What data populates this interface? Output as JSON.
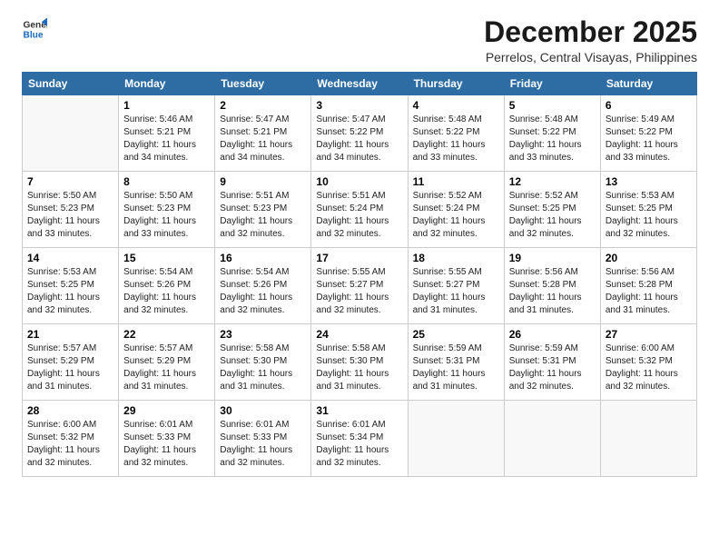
{
  "logo": {
    "general": "General",
    "blue": "Blue"
  },
  "title": "December 2025",
  "location": "Perrelos, Central Visayas, Philippines",
  "headers": [
    "Sunday",
    "Monday",
    "Tuesday",
    "Wednesday",
    "Thursday",
    "Friday",
    "Saturday"
  ],
  "weeks": [
    [
      {
        "day": "",
        "sunrise": "",
        "sunset": "",
        "daylight": "",
        "empty": true
      },
      {
        "day": "1",
        "sunrise": "Sunrise: 5:46 AM",
        "sunset": "Sunset: 5:21 PM",
        "daylight": "Daylight: 11 hours and 34 minutes."
      },
      {
        "day": "2",
        "sunrise": "Sunrise: 5:47 AM",
        "sunset": "Sunset: 5:21 PM",
        "daylight": "Daylight: 11 hours and 34 minutes."
      },
      {
        "day": "3",
        "sunrise": "Sunrise: 5:47 AM",
        "sunset": "Sunset: 5:22 PM",
        "daylight": "Daylight: 11 hours and 34 minutes."
      },
      {
        "day": "4",
        "sunrise": "Sunrise: 5:48 AM",
        "sunset": "Sunset: 5:22 PM",
        "daylight": "Daylight: 11 hours and 33 minutes."
      },
      {
        "day": "5",
        "sunrise": "Sunrise: 5:48 AM",
        "sunset": "Sunset: 5:22 PM",
        "daylight": "Daylight: 11 hours and 33 minutes."
      },
      {
        "day": "6",
        "sunrise": "Sunrise: 5:49 AM",
        "sunset": "Sunset: 5:22 PM",
        "daylight": "Daylight: 11 hours and 33 minutes."
      }
    ],
    [
      {
        "day": "7",
        "sunrise": "Sunrise: 5:50 AM",
        "sunset": "Sunset: 5:23 PM",
        "daylight": "Daylight: 11 hours and 33 minutes."
      },
      {
        "day": "8",
        "sunrise": "Sunrise: 5:50 AM",
        "sunset": "Sunset: 5:23 PM",
        "daylight": "Daylight: 11 hours and 33 minutes."
      },
      {
        "day": "9",
        "sunrise": "Sunrise: 5:51 AM",
        "sunset": "Sunset: 5:23 PM",
        "daylight": "Daylight: 11 hours and 32 minutes."
      },
      {
        "day": "10",
        "sunrise": "Sunrise: 5:51 AM",
        "sunset": "Sunset: 5:24 PM",
        "daylight": "Daylight: 11 hours and 32 minutes."
      },
      {
        "day": "11",
        "sunrise": "Sunrise: 5:52 AM",
        "sunset": "Sunset: 5:24 PM",
        "daylight": "Daylight: 11 hours and 32 minutes."
      },
      {
        "day": "12",
        "sunrise": "Sunrise: 5:52 AM",
        "sunset": "Sunset: 5:25 PM",
        "daylight": "Daylight: 11 hours and 32 minutes."
      },
      {
        "day": "13",
        "sunrise": "Sunrise: 5:53 AM",
        "sunset": "Sunset: 5:25 PM",
        "daylight": "Daylight: 11 hours and 32 minutes."
      }
    ],
    [
      {
        "day": "14",
        "sunrise": "Sunrise: 5:53 AM",
        "sunset": "Sunset: 5:25 PM",
        "daylight": "Daylight: 11 hours and 32 minutes."
      },
      {
        "day": "15",
        "sunrise": "Sunrise: 5:54 AM",
        "sunset": "Sunset: 5:26 PM",
        "daylight": "Daylight: 11 hours and 32 minutes."
      },
      {
        "day": "16",
        "sunrise": "Sunrise: 5:54 AM",
        "sunset": "Sunset: 5:26 PM",
        "daylight": "Daylight: 11 hours and 32 minutes."
      },
      {
        "day": "17",
        "sunrise": "Sunrise: 5:55 AM",
        "sunset": "Sunset: 5:27 PM",
        "daylight": "Daylight: 11 hours and 32 minutes."
      },
      {
        "day": "18",
        "sunrise": "Sunrise: 5:55 AM",
        "sunset": "Sunset: 5:27 PM",
        "daylight": "Daylight: 11 hours and 31 minutes."
      },
      {
        "day": "19",
        "sunrise": "Sunrise: 5:56 AM",
        "sunset": "Sunset: 5:28 PM",
        "daylight": "Daylight: 11 hours and 31 minutes."
      },
      {
        "day": "20",
        "sunrise": "Sunrise: 5:56 AM",
        "sunset": "Sunset: 5:28 PM",
        "daylight": "Daylight: 11 hours and 31 minutes."
      }
    ],
    [
      {
        "day": "21",
        "sunrise": "Sunrise: 5:57 AM",
        "sunset": "Sunset: 5:29 PM",
        "daylight": "Daylight: 11 hours and 31 minutes."
      },
      {
        "day": "22",
        "sunrise": "Sunrise: 5:57 AM",
        "sunset": "Sunset: 5:29 PM",
        "daylight": "Daylight: 11 hours and 31 minutes."
      },
      {
        "day": "23",
        "sunrise": "Sunrise: 5:58 AM",
        "sunset": "Sunset: 5:30 PM",
        "daylight": "Daylight: 11 hours and 31 minutes."
      },
      {
        "day": "24",
        "sunrise": "Sunrise: 5:58 AM",
        "sunset": "Sunset: 5:30 PM",
        "daylight": "Daylight: 11 hours and 31 minutes."
      },
      {
        "day": "25",
        "sunrise": "Sunrise: 5:59 AM",
        "sunset": "Sunset: 5:31 PM",
        "daylight": "Daylight: 11 hours and 31 minutes."
      },
      {
        "day": "26",
        "sunrise": "Sunrise: 5:59 AM",
        "sunset": "Sunset: 5:31 PM",
        "daylight": "Daylight: 11 hours and 32 minutes."
      },
      {
        "day": "27",
        "sunrise": "Sunrise: 6:00 AM",
        "sunset": "Sunset: 5:32 PM",
        "daylight": "Daylight: 11 hours and 32 minutes."
      }
    ],
    [
      {
        "day": "28",
        "sunrise": "Sunrise: 6:00 AM",
        "sunset": "Sunset: 5:32 PM",
        "daylight": "Daylight: 11 hours and 32 minutes."
      },
      {
        "day": "29",
        "sunrise": "Sunrise: 6:01 AM",
        "sunset": "Sunset: 5:33 PM",
        "daylight": "Daylight: 11 hours and 32 minutes."
      },
      {
        "day": "30",
        "sunrise": "Sunrise: 6:01 AM",
        "sunset": "Sunset: 5:33 PM",
        "daylight": "Daylight: 11 hours and 32 minutes."
      },
      {
        "day": "31",
        "sunrise": "Sunrise: 6:01 AM",
        "sunset": "Sunset: 5:34 PM",
        "daylight": "Daylight: 11 hours and 32 minutes."
      },
      {
        "day": "",
        "sunrise": "",
        "sunset": "",
        "daylight": "",
        "empty": true
      },
      {
        "day": "",
        "sunrise": "",
        "sunset": "",
        "daylight": "",
        "empty": true
      },
      {
        "day": "",
        "sunrise": "",
        "sunset": "",
        "daylight": "",
        "empty": true
      }
    ]
  ]
}
